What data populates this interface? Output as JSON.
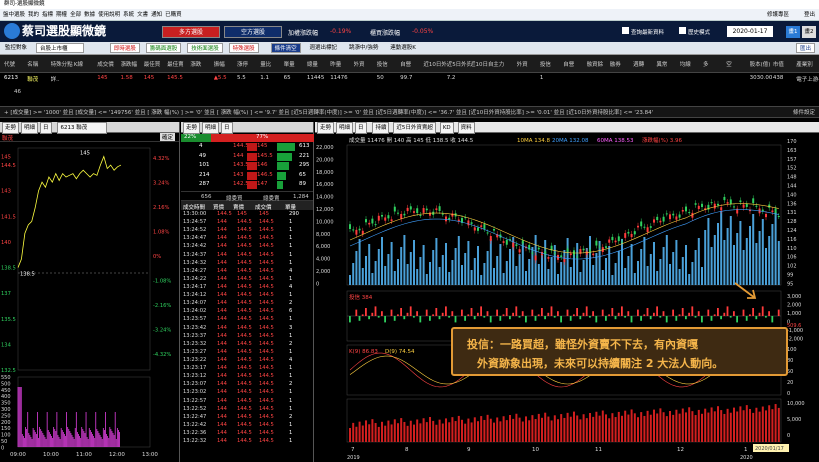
{
  "window": {
    "title": "群司-選股顯微鏡"
  },
  "menubar": {
    "items": [
      "盤中選股",
      "我的",
      "指標",
      "期權",
      "全部",
      "數據",
      "使用說明",
      "系統",
      "文書",
      "通知",
      "已購買"
    ],
    "right_items": [
      "修護專區",
      "登出"
    ]
  },
  "banner": {
    "app_title": "蔡司選股顯微鏡",
    "btn_long": "多方選股",
    "btn_short": "空方選股",
    "stat1_label": "加權漲跌幅",
    "stat1_value": "-0.19%",
    "stat2_label": "櫃買漲跌幅",
    "stat2_value": "-0.05%",
    "chk1": "查詢最新資料",
    "chk2": "歷史模式",
    "date": "2020-01-17",
    "view1": "畫1",
    "view2": "畫2"
  },
  "toolbar": {
    "monitor_label": "監控對象",
    "market": "台股上市櫃",
    "items": [
      "即時選股",
      "籌碼面選股",
      "技術面選股",
      "特殊選股"
    ],
    "clear": "條件清空",
    "chk_a": "週選出標記",
    "chk_b": "跳漲中/強勢",
    "chk_c": "連動選股K",
    "export": "匯出"
  },
  "quote_table": {
    "headers": [
      "代號",
      "名稱",
      "特殊分點",
      "K線",
      "成交價",
      "漲跌幅",
      "最佳買",
      "最佳賣",
      "漲跌",
      "振幅",
      "漲停",
      "量比",
      "單量",
      "總量",
      "昨量",
      "外資",
      "投信",
      "自營",
      "近10日外資",
      "近5日外資",
      "近10日自營",
      "主力",
      "外資",
      "投信",
      "自營",
      "融資餘",
      "融券",
      "週轉",
      "異常",
      "均線",
      "多",
      "空",
      "股本(億)",
      "市值",
      "產業別"
    ],
    "row": [
      "6213",
      "聯茂",
      "詳..",
      "",
      "145",
      "1.58",
      "145",
      "145.5",
      "",
      "▲5.5",
      "5.5",
      "1.1",
      "65",
      "11445",
      "11476",
      "",
      "50",
      "99.7",
      "",
      "7.2",
      "",
      "",
      "",
      "1",
      "",
      "",
      "",
      "",
      "",
      "",
      "",
      "",
      "3030.00",
      "438",
      "電子上游-PCB-材料..."
    ],
    "count": "46"
  },
  "filter_text": "+ [成交量] >= '1000' 並且 [成交量] <= '149756' 並且 [ 漲跌 幅(%) ] >= '0' 並且 [ 漲跌 幅(%) ] <= '9.7' 並且 [近5日週轉率(中度)] >= '0' 並且 [近5日週轉率(中度)] <= '36.7' 並且 [近10日外資持股比率] >= '0.01' 並且 [近10日外資持股比率] <= '23.84'",
  "filter_right": "條件設定",
  "intraday": {
    "tabs": [
      "走勢",
      "明細",
      "日"
    ],
    "stock": "6213 聯茂",
    "name": "聯茂",
    "confirm": "確定",
    "price_ticks": [
      "145",
      "144.5",
      "143",
      "141.5",
      "140",
      "138.5",
      "137",
      "135.5",
      "134",
      "132.5"
    ],
    "pct_ticks": [
      "4.32%",
      "3.24%",
      "2.16%",
      "1.08%",
      "0%",
      "-1.08%",
      "-2.16%",
      "-3.24%",
      "-4.32%"
    ],
    "vol_ticks": [
      "550",
      "500",
      "450",
      "400",
      "350",
      "300",
      "250",
      "200",
      "150",
      "100",
      "50",
      "0"
    ],
    "times": [
      "09:00",
      "10:00",
      "11:00",
      "12:00",
      "13:00"
    ],
    "marks": {
      "high": "145",
      "low": "138.5"
    },
    "prices": [
      138.5,
      139,
      140.5,
      141,
      141.2,
      142,
      143,
      143.5,
      143.2,
      143.8,
      143.5,
      144,
      143.6,
      144,
      143.8,
      143.9,
      144,
      143.7,
      144,
      144.2,
      144,
      143.8,
      144,
      143.9,
      144.5,
      145,
      144.3,
      144.5,
      144.2,
      144.4,
      144.5
    ]
  },
  "order_book": {
    "tabs": [
      "走勢",
      "明細",
      "日"
    ],
    "bid_pct": "22%",
    "ask_pct": "77%",
    "rows": [
      [
        "4",
        "144.5",
        "145",
        "613"
      ],
      [
        "49",
        "144",
        "145.5",
        "221"
      ],
      [
        "101",
        "143.5",
        "146",
        "295"
      ],
      [
        "214",
        "143",
        "146.5",
        "65"
      ],
      [
        "287",
        "142.5",
        "147",
        "89"
      ]
    ],
    "bid_total": "656",
    "bid_total_label": "總委買",
    "ask_total": "1,284",
    "ask_total_label": "總委賣",
    "cols": [
      "成交時間",
      "買價",
      "賣價",
      "成交價",
      "單量"
    ],
    "trades": [
      [
        "13:30:00",
        "144.5",
        "145",
        "145",
        "290"
      ],
      [
        "13:24:57",
        "144",
        "144.5",
        "144.5",
        "1"
      ],
      [
        "13:24:52",
        "144",
        "144.5",
        "144.5",
        "1"
      ],
      [
        "13:24:47",
        "144",
        "144.5",
        "144.5",
        "1"
      ],
      [
        "13:24:42",
        "144",
        "144.5",
        "144.5",
        "1"
      ],
      [
        "13:24:37",
        "144",
        "144.5",
        "144.5",
        "1"
      ],
      [
        "13:24:32",
        "144",
        "144.5",
        "144.5",
        "1"
      ],
      [
        "13:24:27",
        "144",
        "144.5",
        "144.5",
        "4"
      ],
      [
        "13:24:22",
        "144",
        "144.5",
        "144.5",
        "1"
      ],
      [
        "13:24:17",
        "144",
        "144.5",
        "144.5",
        "4"
      ],
      [
        "13:24:12",
        "144",
        "144.5",
        "144.5",
        "1"
      ],
      [
        "13:24:07",
        "144",
        "144.5",
        "144.5",
        "2"
      ],
      [
        "13:24:02",
        "144",
        "144.5",
        "144.5",
        "6"
      ],
      [
        "13:23:57",
        "144",
        "144.5",
        "144.5",
        "1"
      ],
      [
        "13:23:42",
        "144",
        "144.5",
        "144.5",
        "3"
      ],
      [
        "13:23:37",
        "144",
        "144.5",
        "144.5",
        "1"
      ],
      [
        "13:23:32",
        "144",
        "144.5",
        "144.5",
        "2"
      ],
      [
        "13:23:27",
        "144",
        "144.5",
        "144.5",
        "1"
      ],
      [
        "13:23:22",
        "144",
        "144.5",
        "144.5",
        "4"
      ],
      [
        "13:23:17",
        "144",
        "144.5",
        "144.5",
        "1"
      ],
      [
        "13:23:12",
        "144",
        "144.5",
        "144.5",
        "1"
      ],
      [
        "13:23:07",
        "144",
        "144.5",
        "144.5",
        "2"
      ],
      [
        "13:23:02",
        "144",
        "144.5",
        "144.5",
        "1"
      ],
      [
        "13:22:57",
        "144",
        "144.5",
        "144.5",
        "1"
      ],
      [
        "13:22:52",
        "144",
        "144.5",
        "144.5",
        "1"
      ],
      [
        "13:22:47",
        "144",
        "144.5",
        "144.5",
        "2"
      ],
      [
        "13:22:42",
        "144",
        "144.5",
        "144.5",
        "1"
      ],
      [
        "13:22:36",
        "144",
        "144.5",
        "144.5",
        "1"
      ],
      [
        "13:22:32",
        "144",
        "144.5",
        "144.5",
        "1"
      ]
    ]
  },
  "daily": {
    "tabs": [
      "走勢",
      "明細",
      "日"
    ],
    "ctrl": [
      "持續",
      "近5日外資賣超",
      "KD",
      "資料"
    ],
    "info": "成交量 11476  開 140  高 145  低 138.5  收 144.5",
    "ma10": "10MA 134.8",
    "ma20": "20MA 132.08",
    "ma60": "60MA 138.53",
    "chg": "漲跌幅(%) 3.96",
    "vol_ticks": [
      "22,000",
      "20,000",
      "18,000",
      "16,000",
      "14,000",
      "12,000",
      "10,000",
      "8,000",
      "6,000",
      "4,000",
      "2,000",
      "0"
    ],
    "price_ticks": [
      "170",
      "163",
      "157",
      "152",
      "148",
      "144",
      "140",
      "136",
      "131",
      "128",
      "124",
      "116",
      "110",
      "106",
      "102",
      "99",
      "95"
    ],
    "trust_label": "投信 384",
    "trust_ticks": [
      "3,000",
      "2,000",
      "1,000",
      "0",
      "-1,000",
      "-2,000"
    ],
    "trust_mark": "509.6",
    "kd_label": "K(9) 86.83",
    "d_label": "D(9) 74.54",
    "kd_ticks": [
      "100",
      "80",
      "50",
      "20",
      "0"
    ],
    "bot_ticks": [
      "10,000",
      "5,000",
      "0"
    ],
    "months": [
      "7",
      "8",
      "9",
      "10",
      "11",
      "12",
      "1"
    ],
    "years": [
      "2019",
      "2020"
    ],
    "end_date": "2020/01/17"
  },
  "callout": {
    "line1": "投信：一路買超，雖怪外資賣不下去，有內資嘎",
    "line2": "外資跡象出現，未來可以持續關注 2 大法人動向。"
  },
  "colors": {
    "up": "#ff3b3b",
    "down": "#2fd15f",
    "accent": "#e39a35",
    "banner": "#0a1a3a"
  }
}
